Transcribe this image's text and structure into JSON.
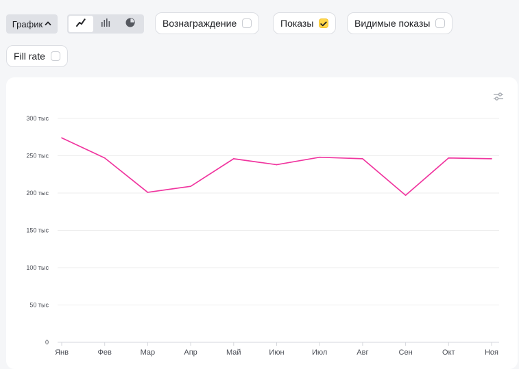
{
  "toolbar": {
    "view_toggle_label": "График",
    "view_modes": [
      {
        "name": "line",
        "active": true
      },
      {
        "name": "bar",
        "active": false
      },
      {
        "name": "pie",
        "active": false
      }
    ]
  },
  "metrics": [
    {
      "label": "Вознаграждение",
      "checked": false
    },
    {
      "label": "Показы",
      "checked": true
    },
    {
      "label": "Видимые показы",
      "checked": false
    },
    {
      "label": "Fill rate",
      "checked": false
    }
  ],
  "colors": {
    "series": "#f0359f",
    "grid": "#ececec",
    "axis_text": "#4a4d55",
    "check_accent": "#ffd64a"
  },
  "chart_data": {
    "type": "line",
    "categories": [
      "Янв",
      "Фев",
      "Мар",
      "Апр",
      "Май",
      "Июн",
      "Июл",
      "Авг",
      "Сен",
      "Окт",
      "Ноя"
    ],
    "series": [
      {
        "values": [
          274000,
          247000,
          201000,
          209000,
          246000,
          238000,
          248000,
          246000,
          197000,
          247000,
          246000
        ]
      }
    ],
    "ylim": [
      0,
      300000
    ],
    "yticks": [
      0,
      50000,
      100000,
      150000,
      200000,
      250000,
      300000
    ],
    "ytick_labels": [
      "0",
      "50 тыс",
      "100 тыс",
      "150 тыс",
      "200 тыс",
      "250 тыс",
      "300 тыс"
    ],
    "grid": true,
    "legend": false
  }
}
